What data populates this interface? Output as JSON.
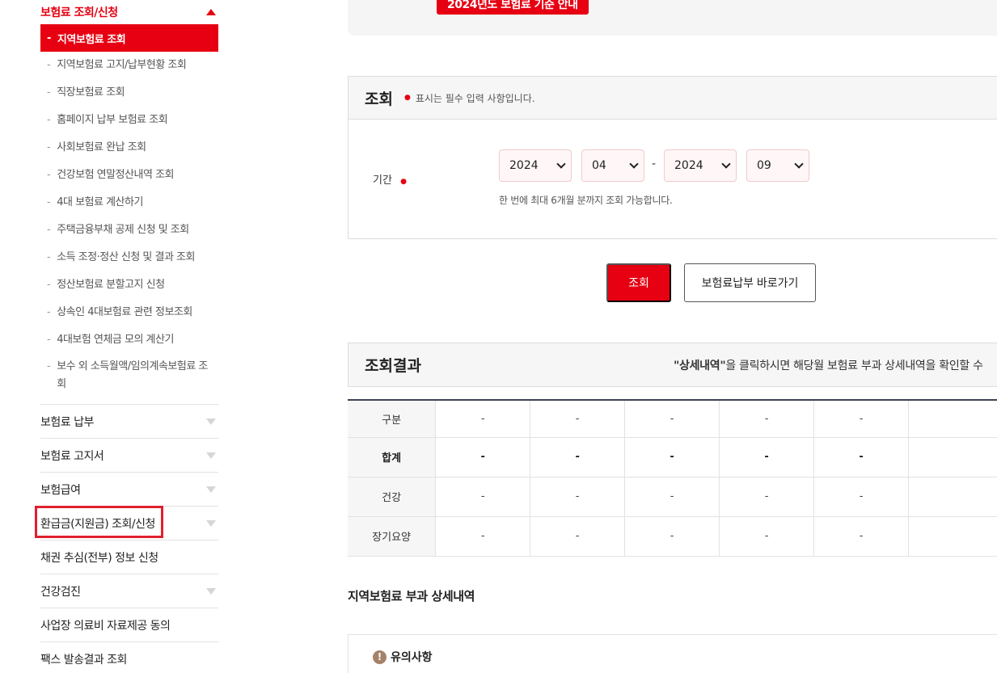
{
  "sidebar": {
    "active_section": "보험료 조회/신청",
    "active_sub": "지역보험료 조회",
    "sub_items": [
      "지역보험료 고지/납부현황 조회",
      "직장보험료 조회",
      "홈페이지 납부 보험료 조회",
      "사회보험료 완납 조회",
      "건강보험 연말정산내역 조회",
      "4대 보험료 계산하기",
      "주택금융부채 공제 신청 및 조회",
      "소득 조정·정산 신청 및 결과 조회",
      "정산보험료 분할고지 신청",
      "상속인 4대보험료 관련 정보조회",
      "4대보험 연체금 모의 계산기",
      "보수 외 소득월액/임의계속보험료 조회"
    ],
    "sections": [
      {
        "label": "보험료 납부",
        "expandable": true
      },
      {
        "label": "보험료 고지서",
        "expandable": true
      },
      {
        "label": "보험급여",
        "expandable": true
      },
      {
        "label": "환급금(지원금) 조회/신청",
        "expandable": true,
        "highlighted": true
      },
      {
        "label": "채권 추심(전부) 정보 신청",
        "expandable": false
      },
      {
        "label": "건강검진",
        "expandable": true
      },
      {
        "label": "사업장 의료비 자료제공 동의",
        "expandable": false
      },
      {
        "label": "팩스 발송결과 조회",
        "expandable": false
      }
    ]
  },
  "notice_button": "2024년도 보험료 기준 안내",
  "query": {
    "title": "조회",
    "required_note": "표시는 필수 입력 사항입니다.",
    "period_label": "기간",
    "start_year": "2024",
    "start_month": "04",
    "end_year": "2024",
    "end_month": "09",
    "range_separator": "-",
    "hint": "한 번에 최대 6개월 분까지 조회 가능합니다."
  },
  "buttons": {
    "search": "조회",
    "go_payment": "보험료납부 바로가기"
  },
  "result": {
    "title": "조회결과",
    "note_quoted": "\"상세내역\"",
    "note_rest": "을 클릭하시면 해당월 보험료 부과 상세내역을 확인할 수",
    "rows": [
      {
        "label": "구분",
        "values": [
          "-",
          "-",
          "-",
          "-",
          "-"
        ]
      },
      {
        "label": "합계",
        "values": [
          "-",
          "-",
          "-",
          "-",
          "-"
        ]
      },
      {
        "label": "건강",
        "values": [
          "-",
          "-",
          "-",
          "-",
          "-"
        ]
      },
      {
        "label": "장기요양",
        "values": [
          "-",
          "-",
          "-",
          "-",
          "-"
        ]
      }
    ]
  },
  "detail": {
    "title": "지역보험료 부과 상세내역",
    "caution_title": "유의사항"
  },
  "colors": {
    "brand_red": "#e60012",
    "highlight_border": "#e0202e",
    "table_top_border": "#3d4255"
  }
}
